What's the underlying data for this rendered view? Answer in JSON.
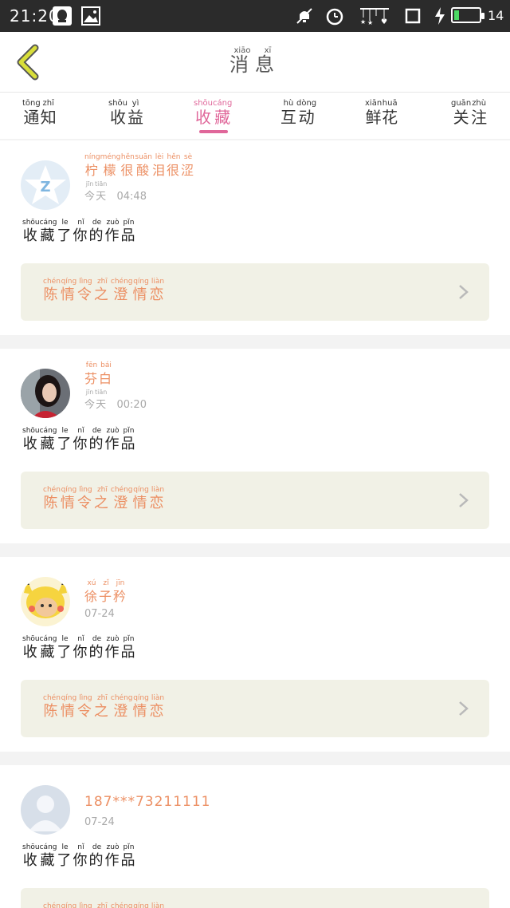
{
  "status_bar": {
    "time": "21:20",
    "battery": "14"
  },
  "header": {
    "title_chars": [
      "消",
      "息"
    ],
    "title_pinyin": [
      "xiāo",
      "xī"
    ]
  },
  "tabs": [
    {
      "zi": [
        "通",
        "知"
      ],
      "py": [
        "tōng",
        "zhī"
      ]
    },
    {
      "zi": [
        "收",
        "益"
      ],
      "py": [
        "shōu",
        "yì"
      ]
    },
    {
      "zi": [
        "收",
        "藏"
      ],
      "py": [
        "shōu",
        "cáng"
      ]
    },
    {
      "zi": [
        "互",
        "动"
      ],
      "py": [
        "hù",
        "dòng"
      ]
    },
    {
      "zi": [
        "鲜",
        "花"
      ],
      "py": [
        "xiān",
        "huā"
      ]
    },
    {
      "zi": [
        "关",
        "注"
      ],
      "py": [
        "guān",
        "zhù"
      ]
    }
  ],
  "action_text": {
    "zi": [
      "收",
      "藏",
      "了",
      "你",
      "的",
      "作",
      "品"
    ],
    "py": [
      "shōu",
      "cáng",
      "le",
      "nǐ",
      "de",
      "zuò",
      "pǐn"
    ]
  },
  "work": {
    "zi": [
      "陈",
      "情",
      "令",
      "之",
      "澄",
      "情",
      "恋"
    ],
    "py": [
      "chén",
      "qíng",
      "lìng",
      "zhī",
      "chéng",
      "qíng",
      "liàn"
    ]
  },
  "notifications": [
    {
      "name_zi": [
        "柠",
        "檬",
        "很",
        "酸",
        "泪",
        "很",
        "涩"
      ],
      "name_py": [
        "níng",
        "méng",
        "hěn",
        "suān",
        "lèi",
        "hěn",
        "sè"
      ],
      "time_prefix_zi": [
        "今",
        "天"
      ],
      "time_prefix_py": [
        "jīn",
        "tiān"
      ],
      "time": "04:48",
      "avatar": "qzone-star"
    },
    {
      "name_zi": [
        "芬",
        "白"
      ],
      "name_py": [
        "fēn",
        "bái"
      ],
      "time_prefix_zi": [
        "今",
        "天"
      ],
      "time_prefix_py": [
        "jīn",
        "tiān"
      ],
      "time": "00:20",
      "avatar": "photo-girl"
    },
    {
      "name_zi": [
        "徐",
        "子",
        "矜"
      ],
      "name_py": [
        "xú",
        "zǐ",
        "jīn"
      ],
      "time_prefix_zi": [],
      "time_prefix_py": [],
      "time": "07-24",
      "avatar": "pikachu-cat"
    },
    {
      "name": "187***73211111",
      "time_prefix_zi": [],
      "time_prefix_py": [],
      "time": "07-24",
      "avatar": "default-user"
    }
  ],
  "colors": {
    "accent": "#e0679a",
    "name": "#ec8f63",
    "back_arrow": "#d8de3a"
  }
}
